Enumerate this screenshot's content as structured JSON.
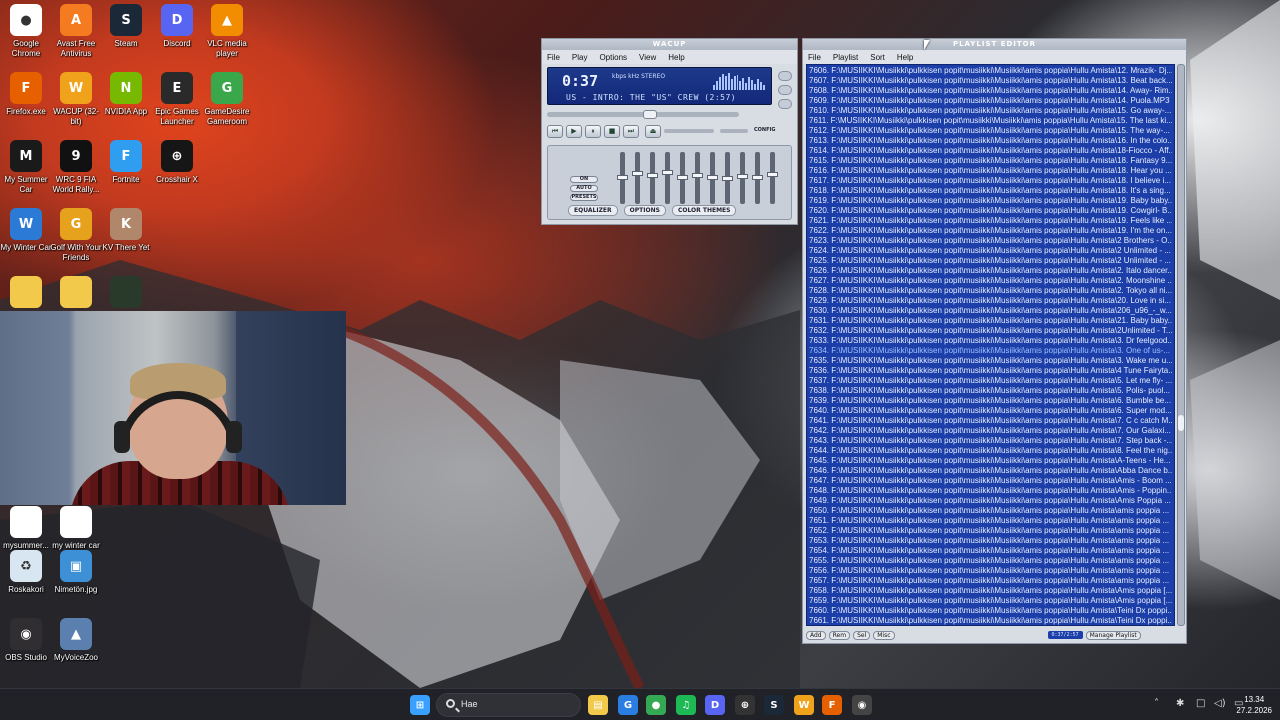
{
  "desktop": {
    "icons": [
      {
        "id": "chrome",
        "label": "Google Chrome",
        "color": "#ffffff",
        "glyph": "●"
      },
      {
        "id": "avast",
        "label": "Avast Free Antivirus",
        "color": "#f47b20",
        "glyph": "A"
      },
      {
        "id": "steam",
        "label": "Steam",
        "color": "#1b2838",
        "glyph": "S"
      },
      {
        "id": "discord",
        "label": "Discord",
        "color": "#5865f2",
        "glyph": "D"
      },
      {
        "id": "vlc",
        "label": "VLC media player",
        "color": "#f28c00",
        "glyph": "▲"
      },
      {
        "id": "firefox",
        "label": "Firefox.exe",
        "color": "#e66000",
        "glyph": "F"
      },
      {
        "id": "wacup",
        "label": "WACUP (32-bit)",
        "color": "#f0a21b",
        "glyph": "W"
      },
      {
        "id": "nvidia",
        "label": "NVIDIA App",
        "color": "#76b900",
        "glyph": "N"
      },
      {
        "id": "epic",
        "label": "Epic Games Launcher",
        "color": "#2a2a2a",
        "glyph": "E"
      },
      {
        "id": "gamedesire",
        "label": "GameDesire Gameroom",
        "color": "#3aa84a",
        "glyph": "G"
      },
      {
        "id": "mysummercar",
        "label": "My Summer Car",
        "color": "#1a1a1a",
        "glyph": "M"
      },
      {
        "id": "wrc9",
        "label": "WRC 9 FIA World Rally...",
        "color": "#111111",
        "glyph": "9"
      },
      {
        "id": "fortnite",
        "label": "Fortnite",
        "color": "#2f9ef0",
        "glyph": "F"
      },
      {
        "id": "crosshairx",
        "label": "Crosshair X",
        "color": "#161616",
        "glyph": "⊕"
      },
      {
        "id": "mywintercar",
        "label": "My Winter Car",
        "color": "#2b7bd6",
        "glyph": "W"
      },
      {
        "id": "golfwithfriends",
        "label": "Golf With Your Friends",
        "color": "#e6a21d",
        "glyph": "G"
      },
      {
        "id": "kvthereyet",
        "label": "KV There Yet",
        "color": "#b0876a",
        "glyph": "K"
      },
      {
        "id": "folder1",
        "label": "",
        "color": "#f3c94b",
        "glyph": ""
      },
      {
        "id": "folder2",
        "label": "",
        "color": "#f3c94b",
        "glyph": ""
      },
      {
        "id": "shortcut",
        "label": "",
        "color": "#2a3a2a",
        "glyph": ""
      },
      {
        "id": "mysummersave",
        "label": "mysummer...",
        "color": "#ffffff",
        "glyph": ""
      },
      {
        "id": "mywintersave",
        "label": "my winter car save",
        "color": "#ffffff",
        "glyph": ""
      },
      {
        "id": "recycle",
        "label": "Roskakori",
        "color": "#d8e6f2",
        "glyph": "♻"
      },
      {
        "id": "nimeton",
        "label": "Nimetön.jpg",
        "color": "#3d8fd6",
        "glyph": "▣"
      },
      {
        "id": "obs",
        "label": "OBS Studio",
        "color": "#302e31",
        "glyph": "◉"
      },
      {
        "id": "myvoicezoo",
        "label": "MyVoiceZoo",
        "color": "#5b7fae",
        "glyph": "▲"
      }
    ]
  },
  "wacup": {
    "title": "WACUP",
    "menu": [
      "File",
      "Play",
      "Options",
      "View",
      "Help"
    ],
    "time": "0:37",
    "badges": "kbps  kHz   STEREO",
    "scroll_text": "US - INTRO: THE \"US\" CREW (2:57)",
    "buttons": {
      "prev": "⏮",
      "play": "▶",
      "pause": "⏸",
      "stop": "■",
      "next": "⏭",
      "eject": "⏏"
    },
    "config_label": "CONFIG",
    "eq_pills": [
      "ON",
      "AUTO",
      "PRESETS"
    ],
    "eq_tabs": [
      "EQUALIZER",
      "OPTIONS",
      "COLOR THEMES"
    ],
    "eq_levels": [
      0.5,
      0.42,
      0.45,
      0.4,
      0.5,
      0.46,
      0.5,
      0.52,
      0.48,
      0.5,
      0.44
    ],
    "spectrum": [
      0.3,
      0.5,
      0.7,
      0.9,
      0.8,
      0.95,
      0.6,
      0.75,
      0.85,
      0.5,
      0.65,
      0.4,
      0.7,
      0.55,
      0.35,
      0.6,
      0.45,
      0.3
    ]
  },
  "playlist": {
    "title": "PLAYLIST EDITOR",
    "menu": [
      "File",
      "Playlist",
      "Sort",
      "Help"
    ],
    "current_index": 28,
    "items": [
      "7606. F:\\MUSIIKKI\\Musiikki\\pulkkisen popit\\musiikki\\Musiikki\\amis poppia\\Hullu Amista\\12. Mrazik- Dj...",
      "7607. F:\\MUSIIKKI\\Musiikki\\pulkkisen popit\\musiikki\\Musiikki\\amis poppia\\Hullu Amista\\13. Beat back...",
      "7608. F:\\MUSIIKKI\\Musiikki\\pulkkisen popit\\musiikki\\Musiikki\\amis poppia\\Hullu Amista\\14. Away- Rim...",
      "7609. F:\\MUSIIKKI\\Musiikki\\pulkkisen popit\\musiikki\\Musiikki\\amis poppia\\Hullu Amista\\14. Puola.MP3",
      "7610. F:\\MUSIIKKI\\Musiikki\\pulkkisen popit\\musiikki\\Musiikki\\amis poppia\\Hullu Amista\\15. Go away-...",
      "7611. F:\\MUSIIKKI\\Musiikki\\pulkkisen popit\\musiikki\\Musiikki\\amis poppia\\Hullu Amista\\15. The last ki...",
      "7612. F:\\MUSIIKKI\\Musiikki\\pulkkisen popit\\musiikki\\Musiikki\\amis poppia\\Hullu Amista\\15. The way-...",
      "7613. F:\\MUSIIKKI\\Musiikki\\pulkkisen popit\\musiikki\\Musiikki\\amis poppia\\Hullu Amista\\16. In the colo...",
      "7614. F:\\MUSIIKKI\\Musiikki\\pulkkisen popit\\musiikki\\Musiikki\\amis poppia\\Hullu Amista\\18-Fiocco - Aff...",
      "7615. F:\\MUSIIKKI\\Musiikki\\pulkkisen popit\\musiikki\\Musiikki\\amis poppia\\Hullu Amista\\18. Fantasy 9...",
      "7616. F:\\MUSIIKKI\\Musiikki\\pulkkisen popit\\musiikki\\Musiikki\\amis poppia\\Hullu Amista\\18. Hear you ...",
      "7617. F:\\MUSIIKKI\\Musiikki\\pulkkisen popit\\musiikki\\Musiikki\\amis poppia\\Hullu Amista\\18. I believe i...",
      "7618. F:\\MUSIIKKI\\Musiikki\\pulkkisen popit\\musiikki\\Musiikki\\amis poppia\\Hullu Amista\\18. It's a sing...",
      "7619. F:\\MUSIIKKI\\Musiikki\\pulkkisen popit\\musiikki\\Musiikki\\amis poppia\\Hullu Amista\\19. Baby baby...",
      "7620. F:\\MUSIIKKI\\Musiikki\\pulkkisen popit\\musiikki\\Musiikki\\amis poppia\\Hullu Amista\\19. Cowgirl- B...",
      "7621. F:\\MUSIIKKI\\Musiikki\\pulkkisen popit\\musiikki\\Musiikki\\amis poppia\\Hullu Amista\\19. Feels like ...",
      "7622. F:\\MUSIIKKI\\Musiikki\\pulkkisen popit\\musiikki\\Musiikki\\amis poppia\\Hullu Amista\\19. I'm the on...",
      "7623. F:\\MUSIIKKI\\Musiikki\\pulkkisen popit\\musiikki\\Musiikki\\amis poppia\\Hullu Amista\\2 Brothers - O...",
      "7624. F:\\MUSIIKKI\\Musiikki\\pulkkisen popit\\musiikki\\Musiikki\\amis poppia\\Hullu Amista\\2 Unlimited - ...",
      "7625. F:\\MUSIIKKI\\Musiikki\\pulkkisen popit\\musiikki\\Musiikki\\amis poppia\\Hullu Amista\\2 Unlimited - ...",
      "7626. F:\\MUSIIKKI\\Musiikki\\pulkkisen popit\\musiikki\\Musiikki\\amis poppia\\Hullu Amista\\2. Italo dancer...",
      "7627. F:\\MUSIIKKI\\Musiikki\\pulkkisen popit\\musiikki\\Musiikki\\amis poppia\\Hullu Amista\\2. Moonshine ...",
      "7628. F:\\MUSIIKKI\\Musiikki\\pulkkisen popit\\musiikki\\Musiikki\\amis poppia\\Hullu Amista\\2. Tokyo all ni...",
      "7629. F:\\MUSIIKKI\\Musiikki\\pulkkisen popit\\musiikki\\Musiikki\\amis poppia\\Hullu Amista\\20. Love in si...",
      "7630. F:\\MUSIIKKI\\Musiikki\\pulkkisen popit\\musiikki\\Musiikki\\amis poppia\\Hullu Amista\\206_u96_-_w...",
      "7631. F:\\MUSIIKKI\\Musiikki\\pulkkisen popit\\musiikki\\Musiikki\\amis poppia\\Hullu Amista\\21. Baby baby...",
      "7632. F:\\MUSIIKKI\\Musiikki\\pulkkisen popit\\musiikki\\Musiikki\\amis poppia\\Hullu Amista\\2Unlimited - T...",
      "7633. F:\\MUSIIKKI\\Musiikki\\pulkkisen popit\\musiikki\\Musiikki\\amis poppia\\Hullu Amista\\3. Dr feelgood...",
      "7634. F:\\MUSIIKKI\\Musiikki\\pulkkisen popit\\musiikki\\Musiikki\\amis poppia\\Hullu Amista\\3. One of us-...",
      "7635. F:\\MUSIIKKI\\Musiikki\\pulkkisen popit\\musiikki\\Musiikki\\amis poppia\\Hullu Amista\\3. Wake me u...",
      "7636. F:\\MUSIIKKI\\Musiikki\\pulkkisen popit\\musiikki\\Musiikki\\amis poppia\\Hullu Amista\\4 Tune Fairyta...",
      "7637. F:\\MUSIIKKI\\Musiikki\\pulkkisen popit\\musiikki\\Musiikki\\amis poppia\\Hullu Amista\\5. Let me fly- ...",
      "7638. F:\\MUSIIKKI\\Musiikki\\pulkkisen popit\\musiikki\\Musiikki\\amis poppia\\Hullu Amista\\5. Polis- puol...",
      "7639. F:\\MUSIIKKI\\Musiikki\\pulkkisen popit\\musiikki\\Musiikki\\amis poppia\\Hullu Amista\\6. Bumble be...",
      "7640. F:\\MUSIIKKI\\Musiikki\\pulkkisen popit\\musiikki\\Musiikki\\amis poppia\\Hullu Amista\\6. Super mod...",
      "7641. F:\\MUSIIKKI\\Musiikki\\pulkkisen popit\\musiikki\\Musiikki\\amis poppia\\Hullu Amista\\7. C c catch M...",
      "7642. F:\\MUSIIKKI\\Musiikki\\pulkkisen popit\\musiikki\\Musiikki\\amis poppia\\Hullu Amista\\7. Our Galaxi...",
      "7643. F:\\MUSIIKKI\\Musiikki\\pulkkisen popit\\musiikki\\Musiikki\\amis poppia\\Hullu Amista\\7. Step back -...",
      "7644. F:\\MUSIIKKI\\Musiikki\\pulkkisen popit\\musiikki\\Musiikki\\amis poppia\\Hullu Amista\\8. Feel the nig...",
      "7645. F:\\MUSIIKKI\\Musiikki\\pulkkisen popit\\musiikki\\Musiikki\\amis poppia\\Hullu Amista\\A-Teens - He...",
      "7646. F:\\MUSIIKKI\\Musiikki\\pulkkisen popit\\musiikki\\Musiikki\\amis poppia\\Hullu Amista\\Abba Dance b...",
      "7647. F:\\MUSIIKKI\\Musiikki\\pulkkisen popit\\musiikki\\Musiikki\\amis poppia\\Hullu Amista\\Amis - Boom ...",
      "7648. F:\\MUSIIKKI\\Musiikki\\pulkkisen popit\\musiikki\\Musiikki\\amis poppia\\Hullu Amista\\Amis - Poppin...",
      "7649. F:\\MUSIIKKI\\Musiikki\\pulkkisen popit\\musiikki\\Musiikki\\amis poppia\\Hullu Amista\\Amis Poppia ...",
      "7650. F:\\MUSIIKKI\\Musiikki\\pulkkisen popit\\musiikki\\Musiikki\\amis poppia\\Hullu Amista\\amis poppia ...",
      "7651. F:\\MUSIIKKI\\Musiikki\\pulkkisen popit\\musiikki\\Musiikki\\amis poppia\\Hullu Amista\\amis poppia ...",
      "7652. F:\\MUSIIKKI\\Musiikki\\pulkkisen popit\\musiikki\\Musiikki\\amis poppia\\Hullu Amista\\amis poppia ...",
      "7653. F:\\MUSIIKKI\\Musiikki\\pulkkisen popit\\musiikki\\Musiikki\\amis poppia\\Hullu Amista\\amis poppia ...",
      "7654. F:\\MUSIIKKI\\Musiikki\\pulkkisen popit\\musiikki\\Musiikki\\amis poppia\\Hullu Amista\\amis poppia ...",
      "7655. F:\\MUSIIKKI\\Musiikki\\pulkkisen popit\\musiikki\\Musiikki\\amis poppia\\Hullu Amista\\amis poppia ...",
      "7656. F:\\MUSIIKKI\\Musiikki\\pulkkisen popit\\musiikki\\Musiikki\\amis poppia\\Hullu Amista\\amis poppia ...",
      "7657. F:\\MUSIIKKI\\Musiikki\\pulkkisen popit\\musiikki\\Musiikki\\amis poppia\\Hullu Amista\\amis poppia ...",
      "7658. F:\\MUSIIKKI\\Musiikki\\pulkkisen popit\\musiikki\\Musiikki\\amis poppia\\Hullu Amista\\Amis poppia [...",
      "7659. F:\\MUSIIKKI\\Musiikki\\pulkkisen popit\\musiikki\\Musiikki\\amis poppia\\Hullu Amista\\Amis poppia [...",
      "7660. F:\\MUSIIKKI\\Musiikki\\pulkkisen popit\\musiikki\\Musiikki\\amis poppia\\Hullu Amista\\Teini Dx poppi...",
      "7661. F:\\MUSIIKKI\\Musiikki\\pulkkisen popit\\musiikki\\Musiikki\\amis poppia\\Hullu Amista\\Teini Dx poppi..."
    ],
    "footer_buttons": [
      "Add",
      "Rem",
      "Sel",
      "Misc"
    ],
    "footer_info": "0:37/2:57",
    "manage_label": "Manage Playlist"
  },
  "taskbar": {
    "search_text": "Hae",
    "apps": [
      {
        "id": "start",
        "glyph": "⊞",
        "color": "#3aa0ff"
      },
      {
        "id": "explorer",
        "glyph": "▤",
        "color": "#f3c94b"
      },
      {
        "id": "edge-g",
        "glyph": "G",
        "color": "#2a7de1"
      },
      {
        "id": "chrome",
        "glyph": "●",
        "color": "#34a853"
      },
      {
        "id": "spotify",
        "glyph": "♫",
        "color": "#1db954"
      },
      {
        "id": "discord",
        "glyph": "D",
        "color": "#5865f2"
      },
      {
        "id": "crosshair",
        "glyph": "⊕",
        "color": "#333333"
      },
      {
        "id": "steam",
        "glyph": "S",
        "color": "#1b2838"
      },
      {
        "id": "wacup",
        "glyph": "W",
        "color": "#f0a21b"
      },
      {
        "id": "firefox",
        "glyph": "F",
        "color": "#e66000"
      },
      {
        "id": "obs",
        "glyph": "◉",
        "color": "#444444"
      }
    ],
    "tray": [
      "˄",
      "✱",
      "□",
      "◁)",
      "▭"
    ],
    "time": "13.34",
    "date": "27.2.2026"
  }
}
